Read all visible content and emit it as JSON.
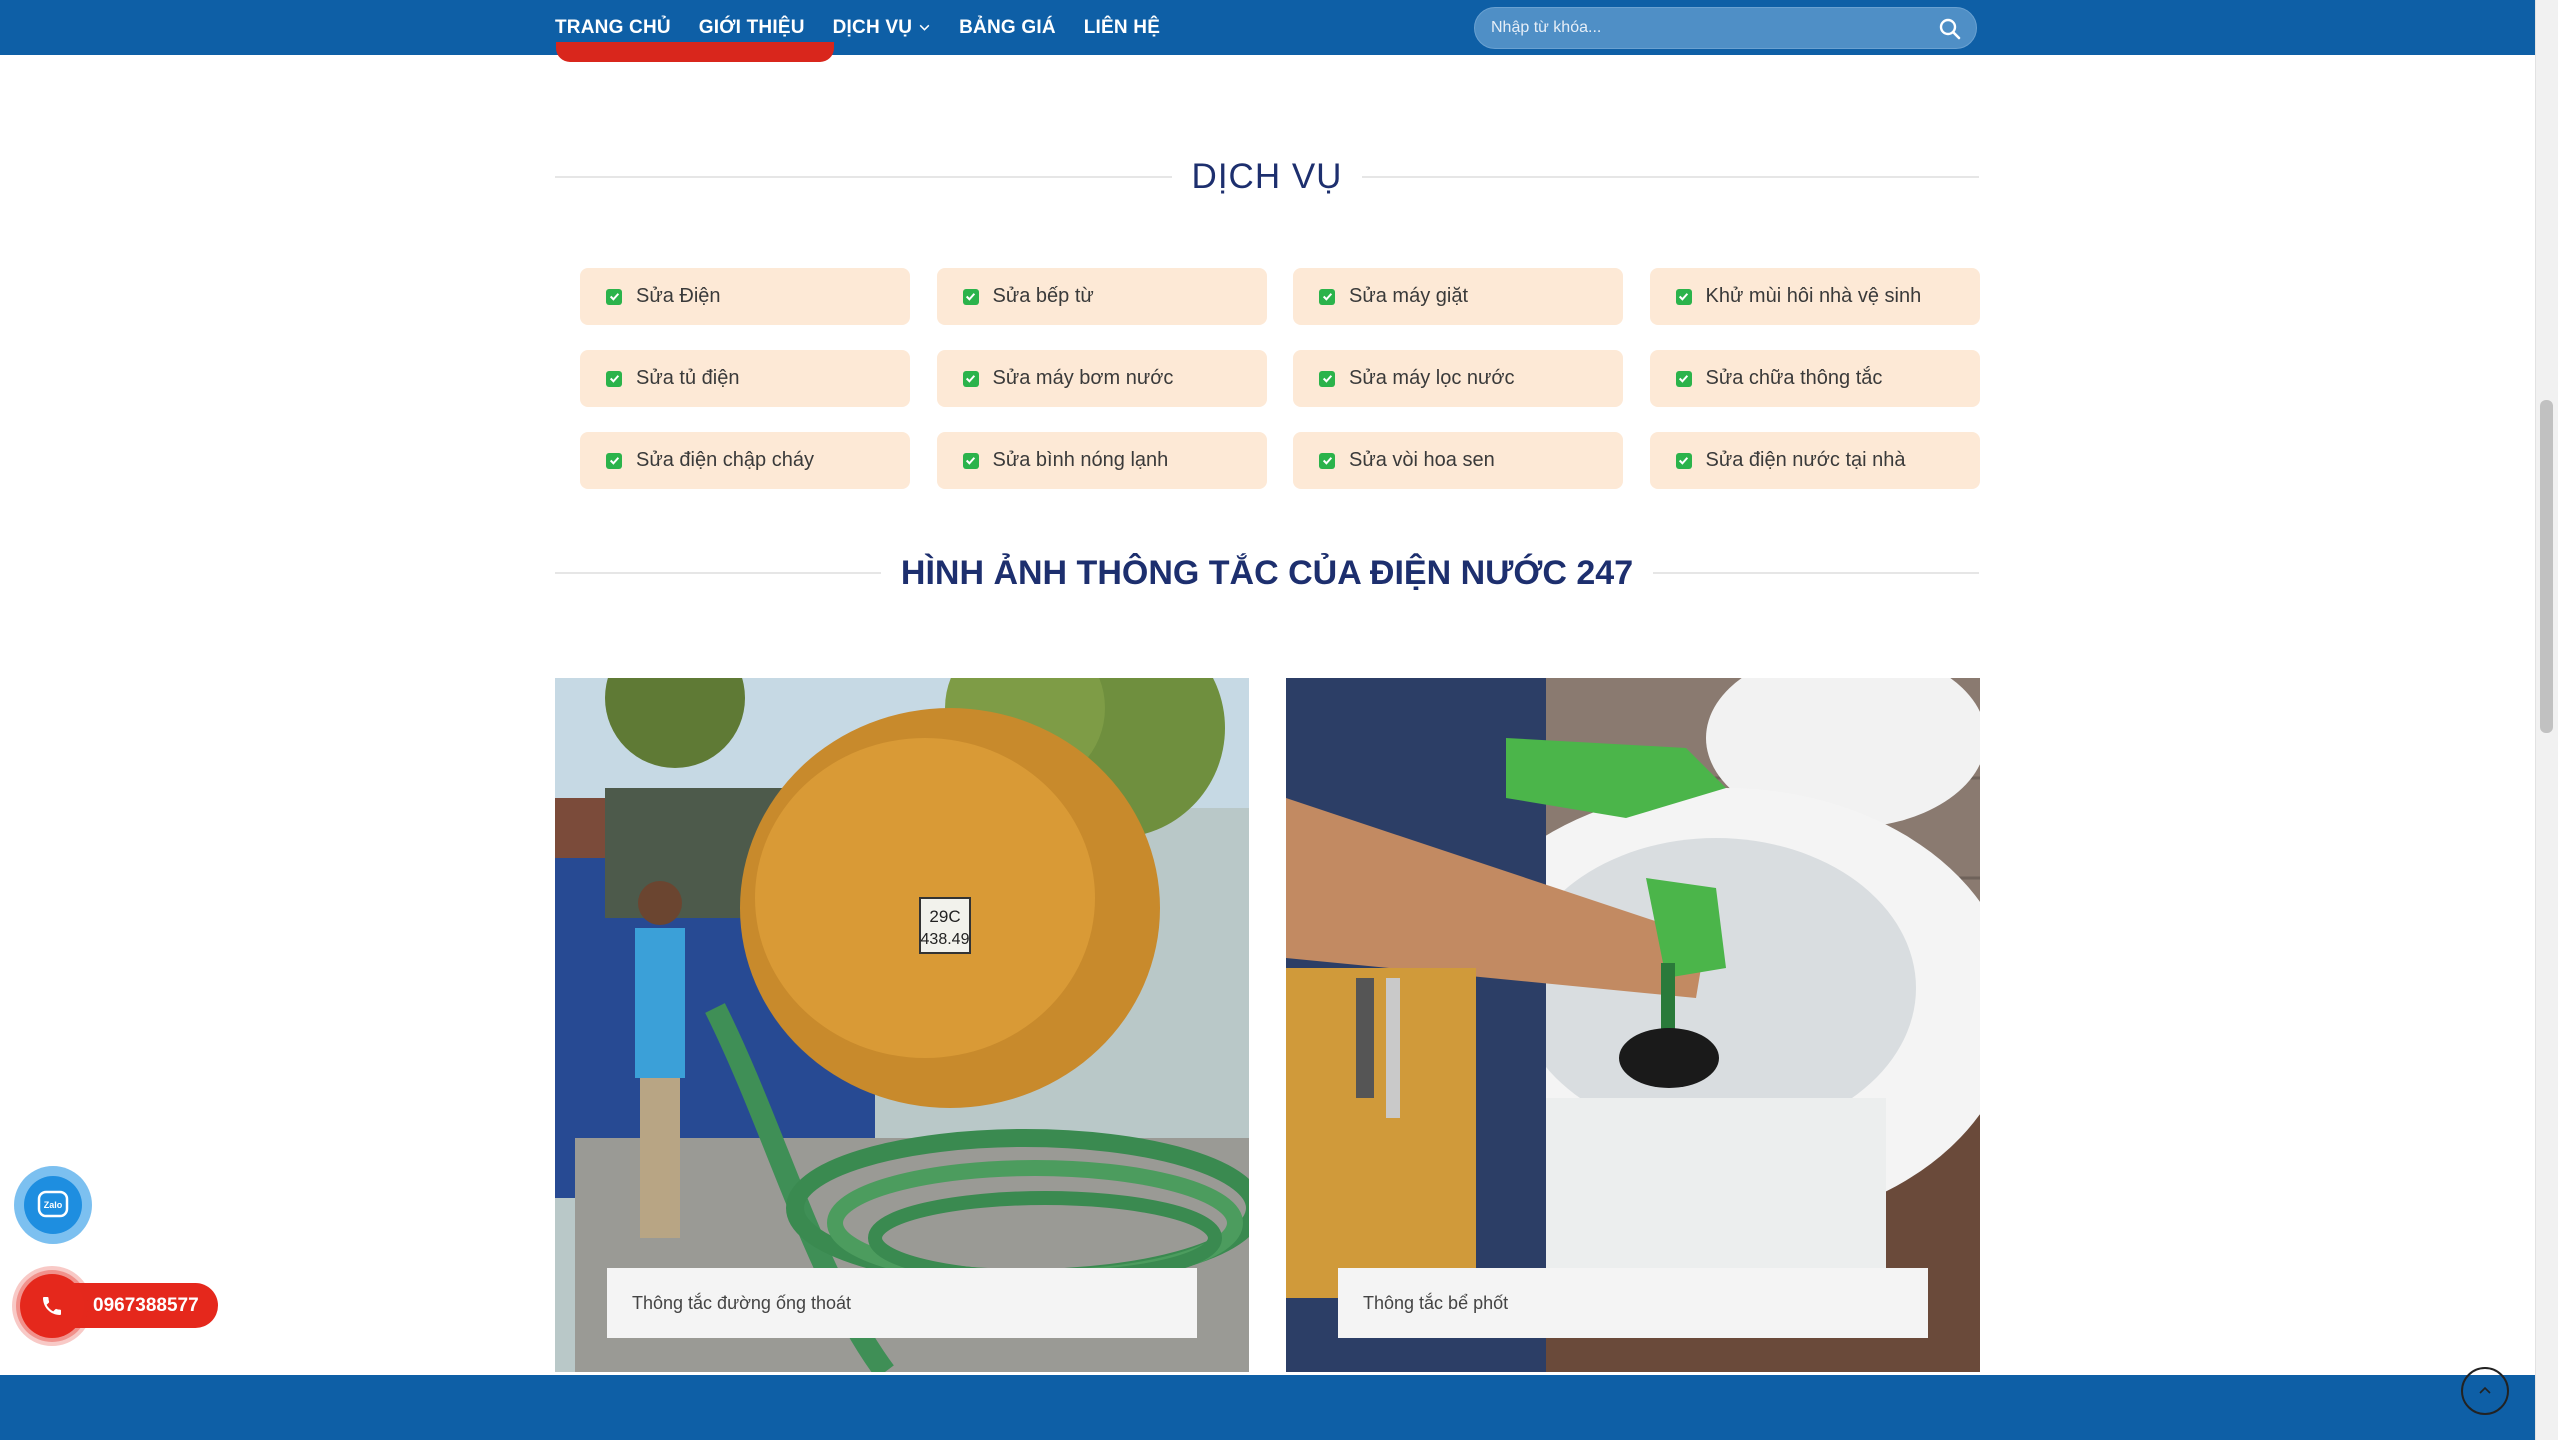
{
  "nav": {
    "items": [
      "TRANG CHỦ",
      "GIỚI THIỆU",
      "DỊCH VỤ",
      "BẢNG GIÁ",
      "LIÊN HỆ"
    ],
    "search_placeholder": "Nhập từ khóa..."
  },
  "services": {
    "title": "DỊCH VỤ",
    "items": [
      "Sửa Điện",
      "Sửa bếp từ",
      "Sửa máy giặt",
      "Khử mùi hôi nhà vệ sinh",
      "Sửa tủ điện",
      "Sửa máy bơm nước",
      "Sửa máy lọc nước",
      "Sửa chữa thông tắc",
      "Sửa điện chập cháy",
      "Sửa bình nóng lạnh",
      "Sửa vòi hoa sen",
      "Sửa điện nước tại nhà"
    ]
  },
  "gallery": {
    "title": "HÌNH ẢNH THÔNG TẮC CỦA ĐIỆN NƯỚC 247",
    "items": [
      {
        "caption": "Thông tắc đường ống thoát",
        "plate": "29C\n438.49"
      },
      {
        "caption": "Thông tắc bể phốt"
      }
    ]
  },
  "contact": {
    "phone": "0967388577",
    "zalo_label": "Zalo"
  },
  "colors": {
    "header": "#0e5fa6",
    "title": "#1d2f6e",
    "service_bg": "#fde9d6",
    "check": "#2bb34b",
    "phone": "#e5281c"
  }
}
